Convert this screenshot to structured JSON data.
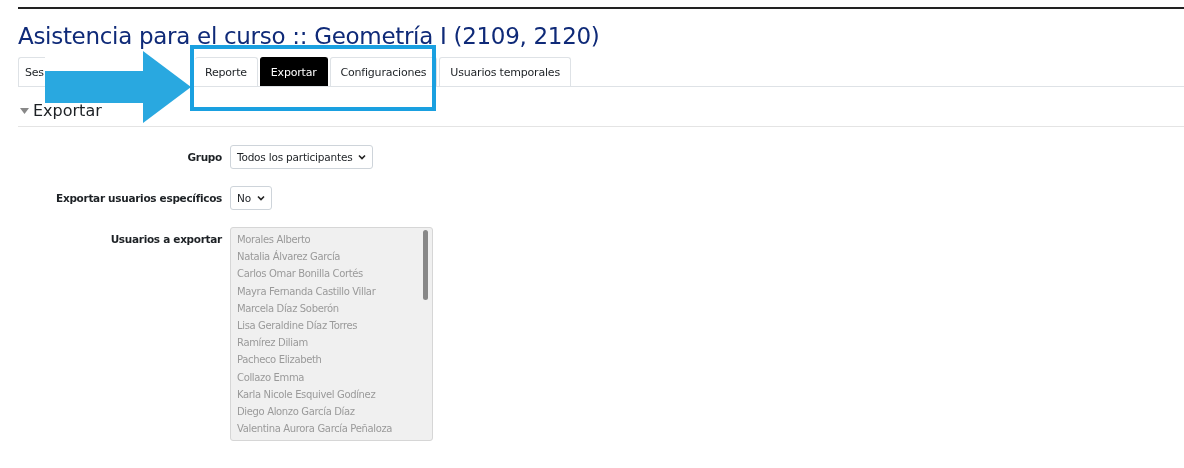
{
  "title": "Asistencia para el curso :: Geometría I (2109, 2120)",
  "tabs": [
    {
      "label": "Ses",
      "selected": false
    },
    {
      "label": "Reporte",
      "selected": false
    },
    {
      "label": "Exportar",
      "selected": true
    },
    {
      "label": "Configuraciones",
      "selected": false
    },
    {
      "label": "Usuarios temporales",
      "selected": false
    }
  ],
  "section": {
    "title": "Exportar",
    "expanded": true
  },
  "fields": [
    {
      "kind": "select",
      "label": "Grupo",
      "value": "Todos los participantes"
    },
    {
      "kind": "select",
      "label": "Exportar usuarios específicos",
      "value": "No"
    },
    {
      "kind": "listbox",
      "label": "Usuarios a exportar",
      "disabled": true,
      "options": [
        "Morales Alberto",
        "Natalia Álvarez García",
        "Carlos Omar Bonilla Cortés",
        "Mayra Fernanda Castillo Villar",
        "Marcela Díaz Soberón",
        "Lisa Geraldine Díaz Torres",
        "Ramírez Diliam",
        "Pacheco Elizabeth",
        "Collazo Emma",
        "Karla Nicole Esquivel Godínez",
        "Diego Alonzo García Díaz",
        "Valentina Aurora García Peñaloza"
      ]
    }
  ]
}
